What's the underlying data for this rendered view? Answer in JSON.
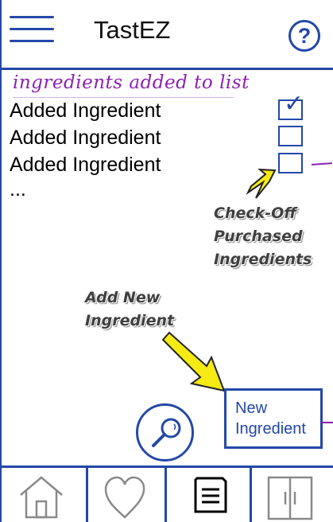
{
  "header": {
    "title": "TastEZ",
    "menu_icon": "hamburger-menu-icon",
    "help_label": "?"
  },
  "list": {
    "heading": "ingredients added to list",
    "items": [
      {
        "label": "Added Ingredient",
        "checked": true
      },
      {
        "label": "Added Ingredient",
        "checked": false
      },
      {
        "label": "Added Ingredient",
        "checked": false
      }
    ],
    "more": "..."
  },
  "annotations": {
    "checkoff_lines": [
      "Check-Off",
      "Purchased",
      "Ingredients"
    ],
    "add_lines": [
      "Add New",
      "Ingredient"
    ]
  },
  "actions": {
    "new_ingredient_line1": "New",
    "new_ingredient_line2": "Ingredient",
    "search_icon": "search-icon"
  },
  "tabs": [
    {
      "id": "home",
      "icon": "home-icon",
      "active": false
    },
    {
      "id": "favorites",
      "icon": "heart-icon",
      "active": false
    },
    {
      "id": "list",
      "icon": "document-icon",
      "active": true
    },
    {
      "id": "pantry",
      "icon": "fridge-icon",
      "active": false
    }
  ],
  "colors": {
    "accent": "#2448a8",
    "handwriting": "#8c1fb3",
    "arrow": "#f5ea14"
  }
}
